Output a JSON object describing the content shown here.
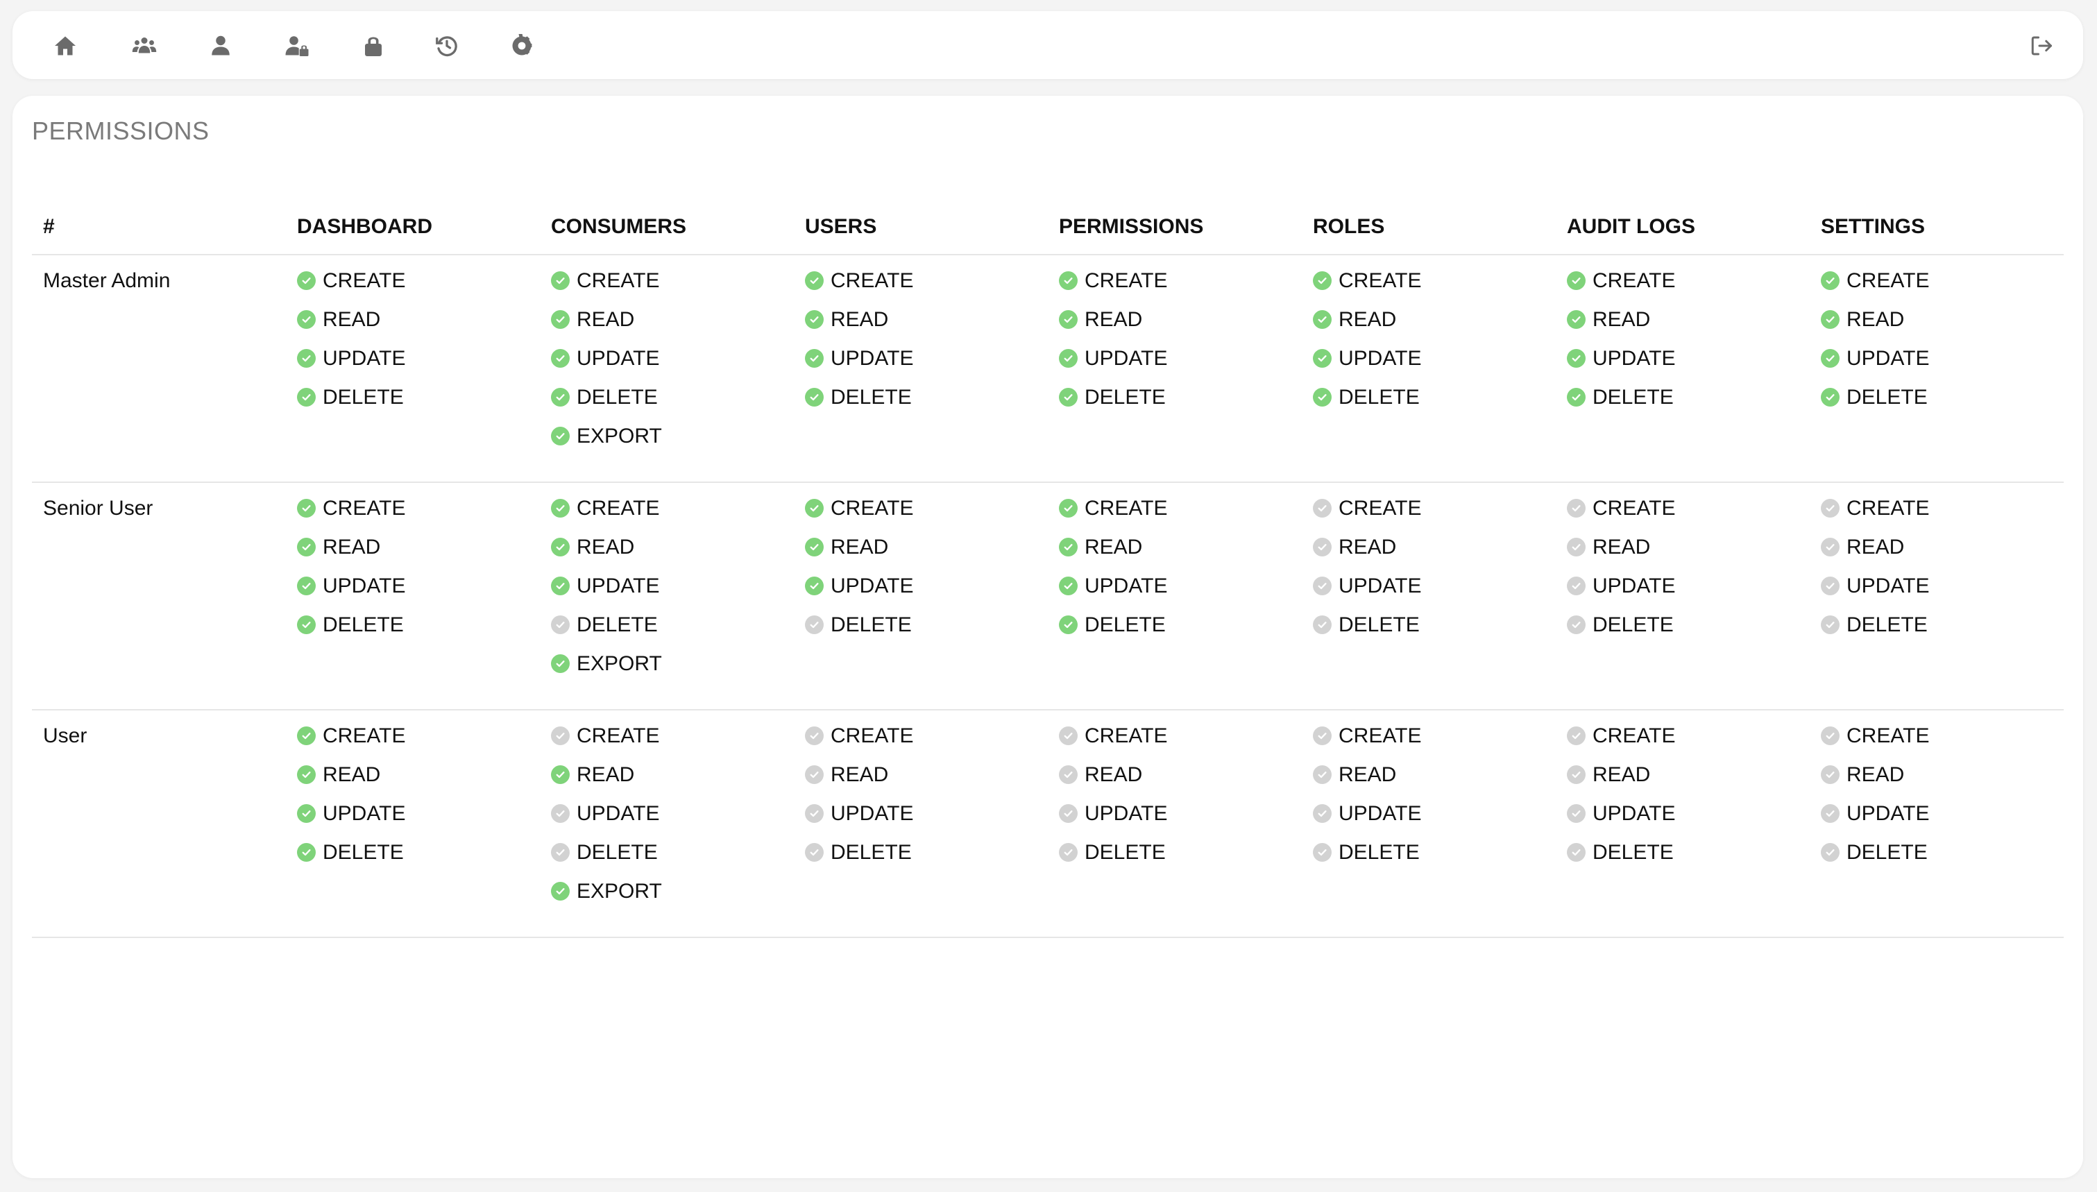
{
  "nav": {
    "icons": [
      "home-icon",
      "users-group-icon",
      "user-icon",
      "user-lock-icon",
      "lock-icon",
      "history-icon",
      "gear-icon"
    ],
    "logout_icon": "sign-out-icon"
  },
  "page": {
    "title": "PERMISSIONS"
  },
  "colors": {
    "granted": "#7fd37a",
    "denied": "#d2d2d2"
  },
  "table": {
    "headers": [
      "#",
      "DASHBOARD",
      "CONSUMERS",
      "USERS",
      "PERMISSIONS",
      "ROLES",
      "AUDIT LOGS",
      "SETTINGS"
    ],
    "rows": [
      {
        "role": "Master Admin",
        "cols": [
          [
            {
              "label": "CREATE",
              "granted": true
            },
            {
              "label": "READ",
              "granted": true
            },
            {
              "label": "UPDATE",
              "granted": true
            },
            {
              "label": "DELETE",
              "granted": true
            }
          ],
          [
            {
              "label": "CREATE",
              "granted": true
            },
            {
              "label": "READ",
              "granted": true
            },
            {
              "label": "UPDATE",
              "granted": true
            },
            {
              "label": "DELETE",
              "granted": true
            },
            {
              "label": "EXPORT",
              "granted": true
            }
          ],
          [
            {
              "label": "CREATE",
              "granted": true
            },
            {
              "label": "READ",
              "granted": true
            },
            {
              "label": "UPDATE",
              "granted": true
            },
            {
              "label": "DELETE",
              "granted": true
            }
          ],
          [
            {
              "label": "CREATE",
              "granted": true
            },
            {
              "label": "READ",
              "granted": true
            },
            {
              "label": "UPDATE",
              "granted": true
            },
            {
              "label": "DELETE",
              "granted": true
            }
          ],
          [
            {
              "label": "CREATE",
              "granted": true
            },
            {
              "label": "READ",
              "granted": true
            },
            {
              "label": "UPDATE",
              "granted": true
            },
            {
              "label": "DELETE",
              "granted": true
            }
          ],
          [
            {
              "label": "CREATE",
              "granted": true
            },
            {
              "label": "READ",
              "granted": true
            },
            {
              "label": "UPDATE",
              "granted": true
            },
            {
              "label": "DELETE",
              "granted": true
            }
          ],
          [
            {
              "label": "CREATE",
              "granted": true
            },
            {
              "label": "READ",
              "granted": true
            },
            {
              "label": "UPDATE",
              "granted": true
            },
            {
              "label": "DELETE",
              "granted": true
            }
          ]
        ]
      },
      {
        "role": "Senior User",
        "cols": [
          [
            {
              "label": "CREATE",
              "granted": true
            },
            {
              "label": "READ",
              "granted": true
            },
            {
              "label": "UPDATE",
              "granted": true
            },
            {
              "label": "DELETE",
              "granted": true
            }
          ],
          [
            {
              "label": "CREATE",
              "granted": true
            },
            {
              "label": "READ",
              "granted": true
            },
            {
              "label": "UPDATE",
              "granted": true
            },
            {
              "label": "DELETE",
              "granted": false
            },
            {
              "label": "EXPORT",
              "granted": true
            }
          ],
          [
            {
              "label": "CREATE",
              "granted": true
            },
            {
              "label": "READ",
              "granted": true
            },
            {
              "label": "UPDATE",
              "granted": true
            },
            {
              "label": "DELETE",
              "granted": false
            }
          ],
          [
            {
              "label": "CREATE",
              "granted": true
            },
            {
              "label": "READ",
              "granted": true
            },
            {
              "label": "UPDATE",
              "granted": true
            },
            {
              "label": "DELETE",
              "granted": true
            }
          ],
          [
            {
              "label": "CREATE",
              "granted": false
            },
            {
              "label": "READ",
              "granted": false
            },
            {
              "label": "UPDATE",
              "granted": false
            },
            {
              "label": "DELETE",
              "granted": false
            }
          ],
          [
            {
              "label": "CREATE",
              "granted": false
            },
            {
              "label": "READ",
              "granted": false
            },
            {
              "label": "UPDATE",
              "granted": false
            },
            {
              "label": "DELETE",
              "granted": false
            }
          ],
          [
            {
              "label": "CREATE",
              "granted": false
            },
            {
              "label": "READ",
              "granted": false
            },
            {
              "label": "UPDATE",
              "granted": false
            },
            {
              "label": "DELETE",
              "granted": false
            }
          ]
        ]
      },
      {
        "role": "User",
        "cols": [
          [
            {
              "label": "CREATE",
              "granted": true
            },
            {
              "label": "READ",
              "granted": true
            },
            {
              "label": "UPDATE",
              "granted": true
            },
            {
              "label": "DELETE",
              "granted": true
            }
          ],
          [
            {
              "label": "CREATE",
              "granted": false
            },
            {
              "label": "READ",
              "granted": true
            },
            {
              "label": "UPDATE",
              "granted": false
            },
            {
              "label": "DELETE",
              "granted": false
            },
            {
              "label": "EXPORT",
              "granted": true
            }
          ],
          [
            {
              "label": "CREATE",
              "granted": false
            },
            {
              "label": "READ",
              "granted": false
            },
            {
              "label": "UPDATE",
              "granted": false
            },
            {
              "label": "DELETE",
              "granted": false
            }
          ],
          [
            {
              "label": "CREATE",
              "granted": false
            },
            {
              "label": "READ",
              "granted": false
            },
            {
              "label": "UPDATE",
              "granted": false
            },
            {
              "label": "DELETE",
              "granted": false
            }
          ],
          [
            {
              "label": "CREATE",
              "granted": false
            },
            {
              "label": "READ",
              "granted": false
            },
            {
              "label": "UPDATE",
              "granted": false
            },
            {
              "label": "DELETE",
              "granted": false
            }
          ],
          [
            {
              "label": "CREATE",
              "granted": false
            },
            {
              "label": "READ",
              "granted": false
            },
            {
              "label": "UPDATE",
              "granted": false
            },
            {
              "label": "DELETE",
              "granted": false
            }
          ],
          [
            {
              "label": "CREATE",
              "granted": false
            },
            {
              "label": "READ",
              "granted": false
            },
            {
              "label": "UPDATE",
              "granted": false
            },
            {
              "label": "DELETE",
              "granted": false
            }
          ]
        ]
      }
    ]
  }
}
